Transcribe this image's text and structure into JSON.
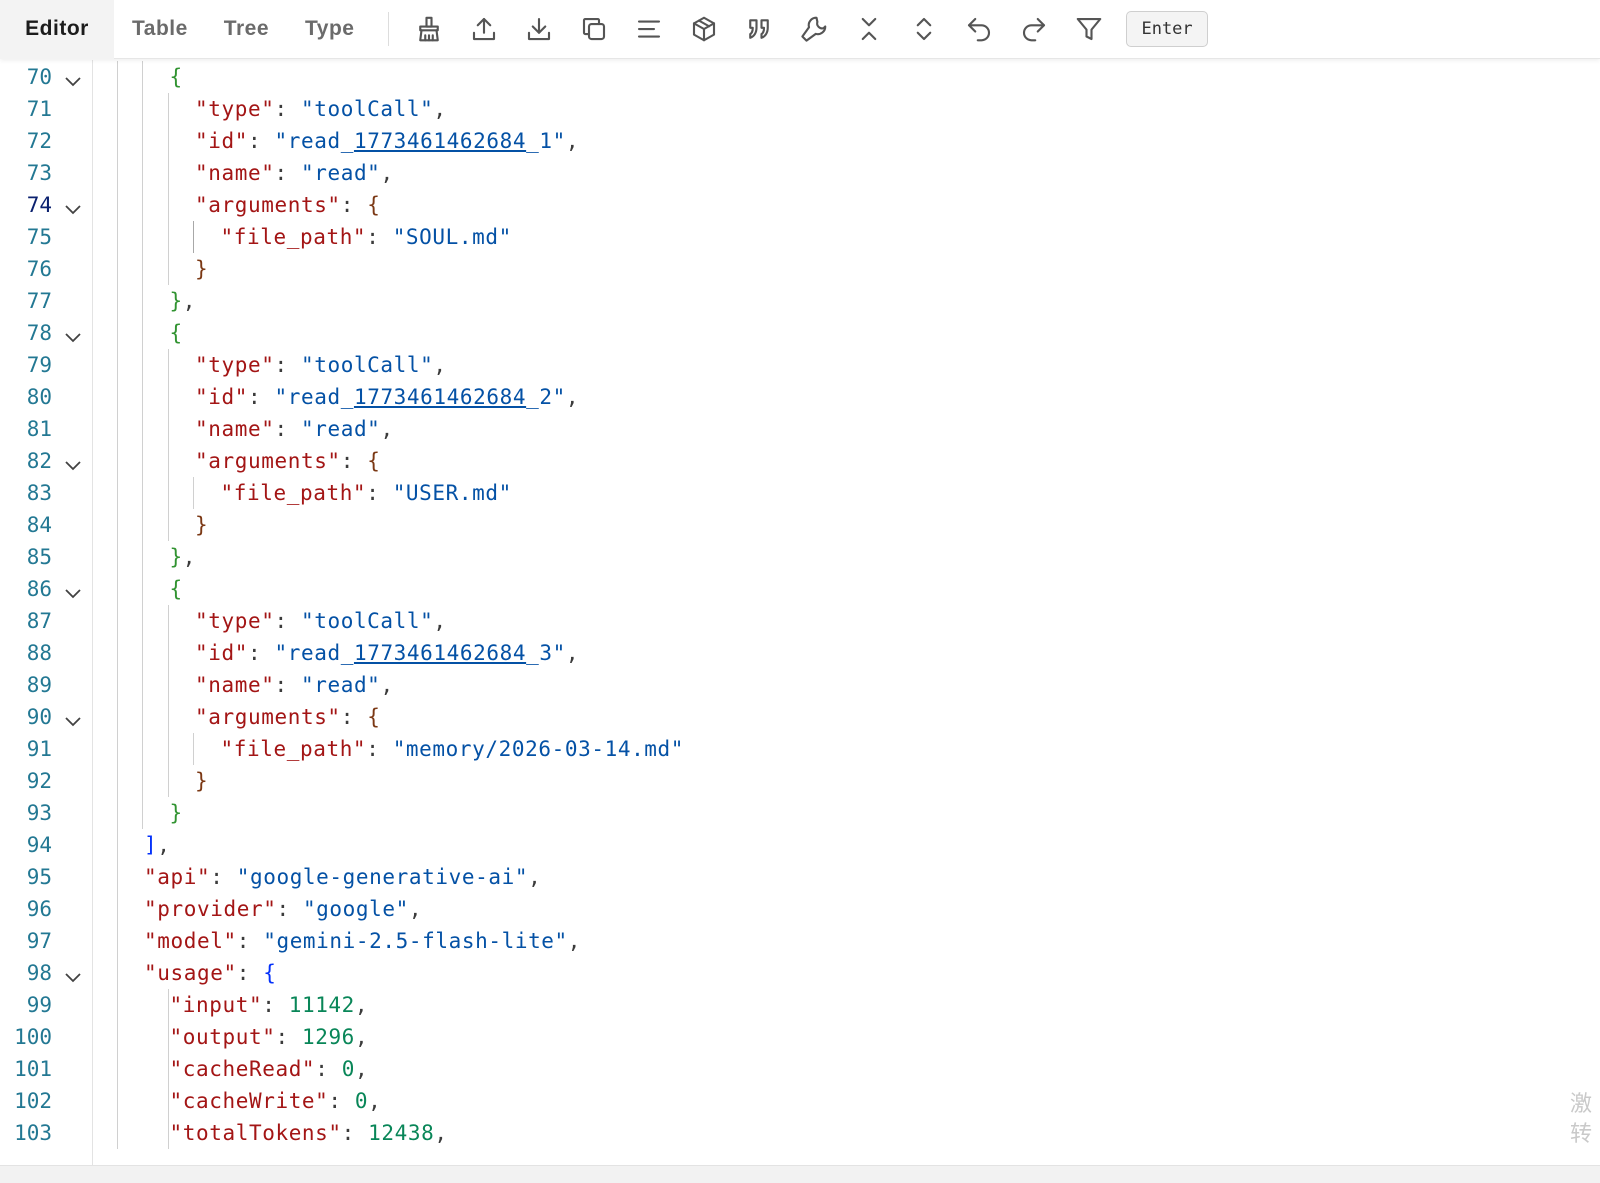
{
  "toolbar": {
    "tabs": [
      {
        "label": "Editor",
        "active": true
      },
      {
        "label": "Table",
        "active": false
      },
      {
        "label": "Tree",
        "active": false
      },
      {
        "label": "Type",
        "active": false
      }
    ],
    "icons": [
      "clean-icon",
      "upload-icon",
      "download-icon",
      "copy-icon",
      "format-icon",
      "package-icon",
      "quote-icon",
      "wrench-icon",
      "collapse-all-icon",
      "expand-all-icon",
      "undo-icon",
      "redo-icon",
      "filter-icon"
    ],
    "enter_label": "Enter"
  },
  "editor": {
    "active_line": 74,
    "lines": [
      {
        "n": "70",
        "fold": true,
        "indent": 3,
        "tokens": [
          [
            "br2",
            "{"
          ]
        ]
      },
      {
        "n": "71",
        "indent": 4,
        "tokens": [
          [
            "key",
            "\"type\""
          ],
          [
            "p",
            ": "
          ],
          [
            "str",
            "\"toolCall\""
          ],
          [
            "p",
            ","
          ]
        ]
      },
      {
        "n": "72",
        "indent": 4,
        "tokens": [
          [
            "key",
            "\"id\""
          ],
          [
            "p",
            ": "
          ],
          [
            "str",
            "\"read_"
          ],
          [
            "link",
            "1773461462684"
          ],
          [
            "str",
            "_1\""
          ],
          [
            "p",
            ","
          ]
        ]
      },
      {
        "n": "73",
        "indent": 4,
        "tokens": [
          [
            "key",
            "\"name\""
          ],
          [
            "p",
            ": "
          ],
          [
            "str",
            "\"read\""
          ],
          [
            "p",
            ","
          ]
        ]
      },
      {
        "n": "74",
        "fold": true,
        "indent": 4,
        "tokens": [
          [
            "key",
            "\"arguments\""
          ],
          [
            "p",
            ": "
          ],
          [
            "br3",
            "{"
          ]
        ]
      },
      {
        "n": "75",
        "indent": 5,
        "tokens": [
          [
            "key",
            "\"file_path\""
          ],
          [
            "p",
            ": "
          ],
          [
            "str",
            "\"SOUL.md\""
          ]
        ]
      },
      {
        "n": "76",
        "indent": 4,
        "tokens": [
          [
            "br3",
            "}"
          ]
        ]
      },
      {
        "n": "77",
        "indent": 3,
        "tokens": [
          [
            "br2",
            "}"
          ],
          [
            "p",
            ","
          ]
        ]
      },
      {
        "n": "78",
        "fold": true,
        "indent": 3,
        "tokens": [
          [
            "br2",
            "{"
          ]
        ]
      },
      {
        "n": "79",
        "indent": 4,
        "tokens": [
          [
            "key",
            "\"type\""
          ],
          [
            "p",
            ": "
          ],
          [
            "str",
            "\"toolCall\""
          ],
          [
            "p",
            ","
          ]
        ]
      },
      {
        "n": "80",
        "indent": 4,
        "tokens": [
          [
            "key",
            "\"id\""
          ],
          [
            "p",
            ": "
          ],
          [
            "str",
            "\"read_"
          ],
          [
            "link",
            "1773461462684"
          ],
          [
            "str",
            "_2\""
          ],
          [
            "p",
            ","
          ]
        ]
      },
      {
        "n": "81",
        "indent": 4,
        "tokens": [
          [
            "key",
            "\"name\""
          ],
          [
            "p",
            ": "
          ],
          [
            "str",
            "\"read\""
          ],
          [
            "p",
            ","
          ]
        ]
      },
      {
        "n": "82",
        "fold": true,
        "indent": 4,
        "tokens": [
          [
            "key",
            "\"arguments\""
          ],
          [
            "p",
            ": "
          ],
          [
            "br3",
            "{"
          ]
        ]
      },
      {
        "n": "83",
        "indent": 5,
        "tokens": [
          [
            "key",
            "\"file_path\""
          ],
          [
            "p",
            ": "
          ],
          [
            "str",
            "\"USER.md\""
          ]
        ]
      },
      {
        "n": "84",
        "indent": 4,
        "tokens": [
          [
            "br3",
            "}"
          ]
        ]
      },
      {
        "n": "85",
        "indent": 3,
        "tokens": [
          [
            "br2",
            "}"
          ],
          [
            "p",
            ","
          ]
        ]
      },
      {
        "n": "86",
        "fold": true,
        "indent": 3,
        "tokens": [
          [
            "br2",
            "{"
          ]
        ]
      },
      {
        "n": "87",
        "indent": 4,
        "tokens": [
          [
            "key",
            "\"type\""
          ],
          [
            "p",
            ": "
          ],
          [
            "str",
            "\"toolCall\""
          ],
          [
            "p",
            ","
          ]
        ]
      },
      {
        "n": "88",
        "indent": 4,
        "tokens": [
          [
            "key",
            "\"id\""
          ],
          [
            "p",
            ": "
          ],
          [
            "str",
            "\"read_"
          ],
          [
            "link",
            "1773461462684"
          ],
          [
            "str",
            "_3\""
          ],
          [
            "p",
            ","
          ]
        ]
      },
      {
        "n": "89",
        "indent": 4,
        "tokens": [
          [
            "key",
            "\"name\""
          ],
          [
            "p",
            ": "
          ],
          [
            "str",
            "\"read\""
          ],
          [
            "p",
            ","
          ]
        ]
      },
      {
        "n": "90",
        "fold": true,
        "indent": 4,
        "tokens": [
          [
            "key",
            "\"arguments\""
          ],
          [
            "p",
            ": "
          ],
          [
            "br3",
            "{"
          ]
        ]
      },
      {
        "n": "91",
        "indent": 5,
        "tokens": [
          [
            "key",
            "\"file_path\""
          ],
          [
            "p",
            ": "
          ],
          [
            "str",
            "\"memory/2026-03-14.md\""
          ]
        ]
      },
      {
        "n": "92",
        "indent": 4,
        "tokens": [
          [
            "br3",
            "}"
          ]
        ]
      },
      {
        "n": "93",
        "indent": 3,
        "tokens": [
          [
            "br2",
            "}"
          ]
        ]
      },
      {
        "n": "94",
        "indent": 2,
        "tokens": [
          [
            "br1",
            "]"
          ],
          [
            "p",
            ","
          ]
        ]
      },
      {
        "n": "95",
        "indent": 2,
        "tokens": [
          [
            "key",
            "\"api\""
          ],
          [
            "p",
            ": "
          ],
          [
            "str",
            "\"google-generative-ai\""
          ],
          [
            "p",
            ","
          ]
        ]
      },
      {
        "n": "96",
        "indent": 2,
        "tokens": [
          [
            "key",
            "\"provider\""
          ],
          [
            "p",
            ": "
          ],
          [
            "str",
            "\"google\""
          ],
          [
            "p",
            ","
          ]
        ]
      },
      {
        "n": "97",
        "indent": 2,
        "tokens": [
          [
            "key",
            "\"model\""
          ],
          [
            "p",
            ": "
          ],
          [
            "str",
            "\"gemini-2.5-flash-lite\""
          ],
          [
            "p",
            ","
          ]
        ]
      },
      {
        "n": "98",
        "fold": true,
        "indent": 2,
        "tokens": [
          [
            "key",
            "\"usage\""
          ],
          [
            "p",
            ": "
          ],
          [
            "br1",
            "{"
          ]
        ]
      },
      {
        "n": "99",
        "indent": 3,
        "tokens": [
          [
            "key",
            "\"input\""
          ],
          [
            "p",
            ": "
          ],
          [
            "num",
            "11142"
          ],
          [
            "p",
            ","
          ]
        ]
      },
      {
        "n": "100",
        "indent": 3,
        "tokens": [
          [
            "key",
            "\"output\""
          ],
          [
            "p",
            ": "
          ],
          [
            "num",
            "1296"
          ],
          [
            "p",
            ","
          ]
        ]
      },
      {
        "n": "101",
        "indent": 3,
        "tokens": [
          [
            "key",
            "\"cacheRead\""
          ],
          [
            "p",
            ": "
          ],
          [
            "num",
            "0"
          ],
          [
            "p",
            ","
          ]
        ]
      },
      {
        "n": "102",
        "indent": 3,
        "tokens": [
          [
            "key",
            "\"cacheWrite\""
          ],
          [
            "p",
            ": "
          ],
          [
            "num",
            "0"
          ],
          [
            "p",
            ","
          ]
        ]
      },
      {
        "n": "103",
        "indent": 3,
        "tokens": [
          [
            "key",
            "\"totalTokens\""
          ],
          [
            "p",
            ": "
          ],
          [
            "num",
            "12438"
          ],
          [
            "p",
            ","
          ]
        ]
      }
    ]
  },
  "watermark": "激\n转"
}
